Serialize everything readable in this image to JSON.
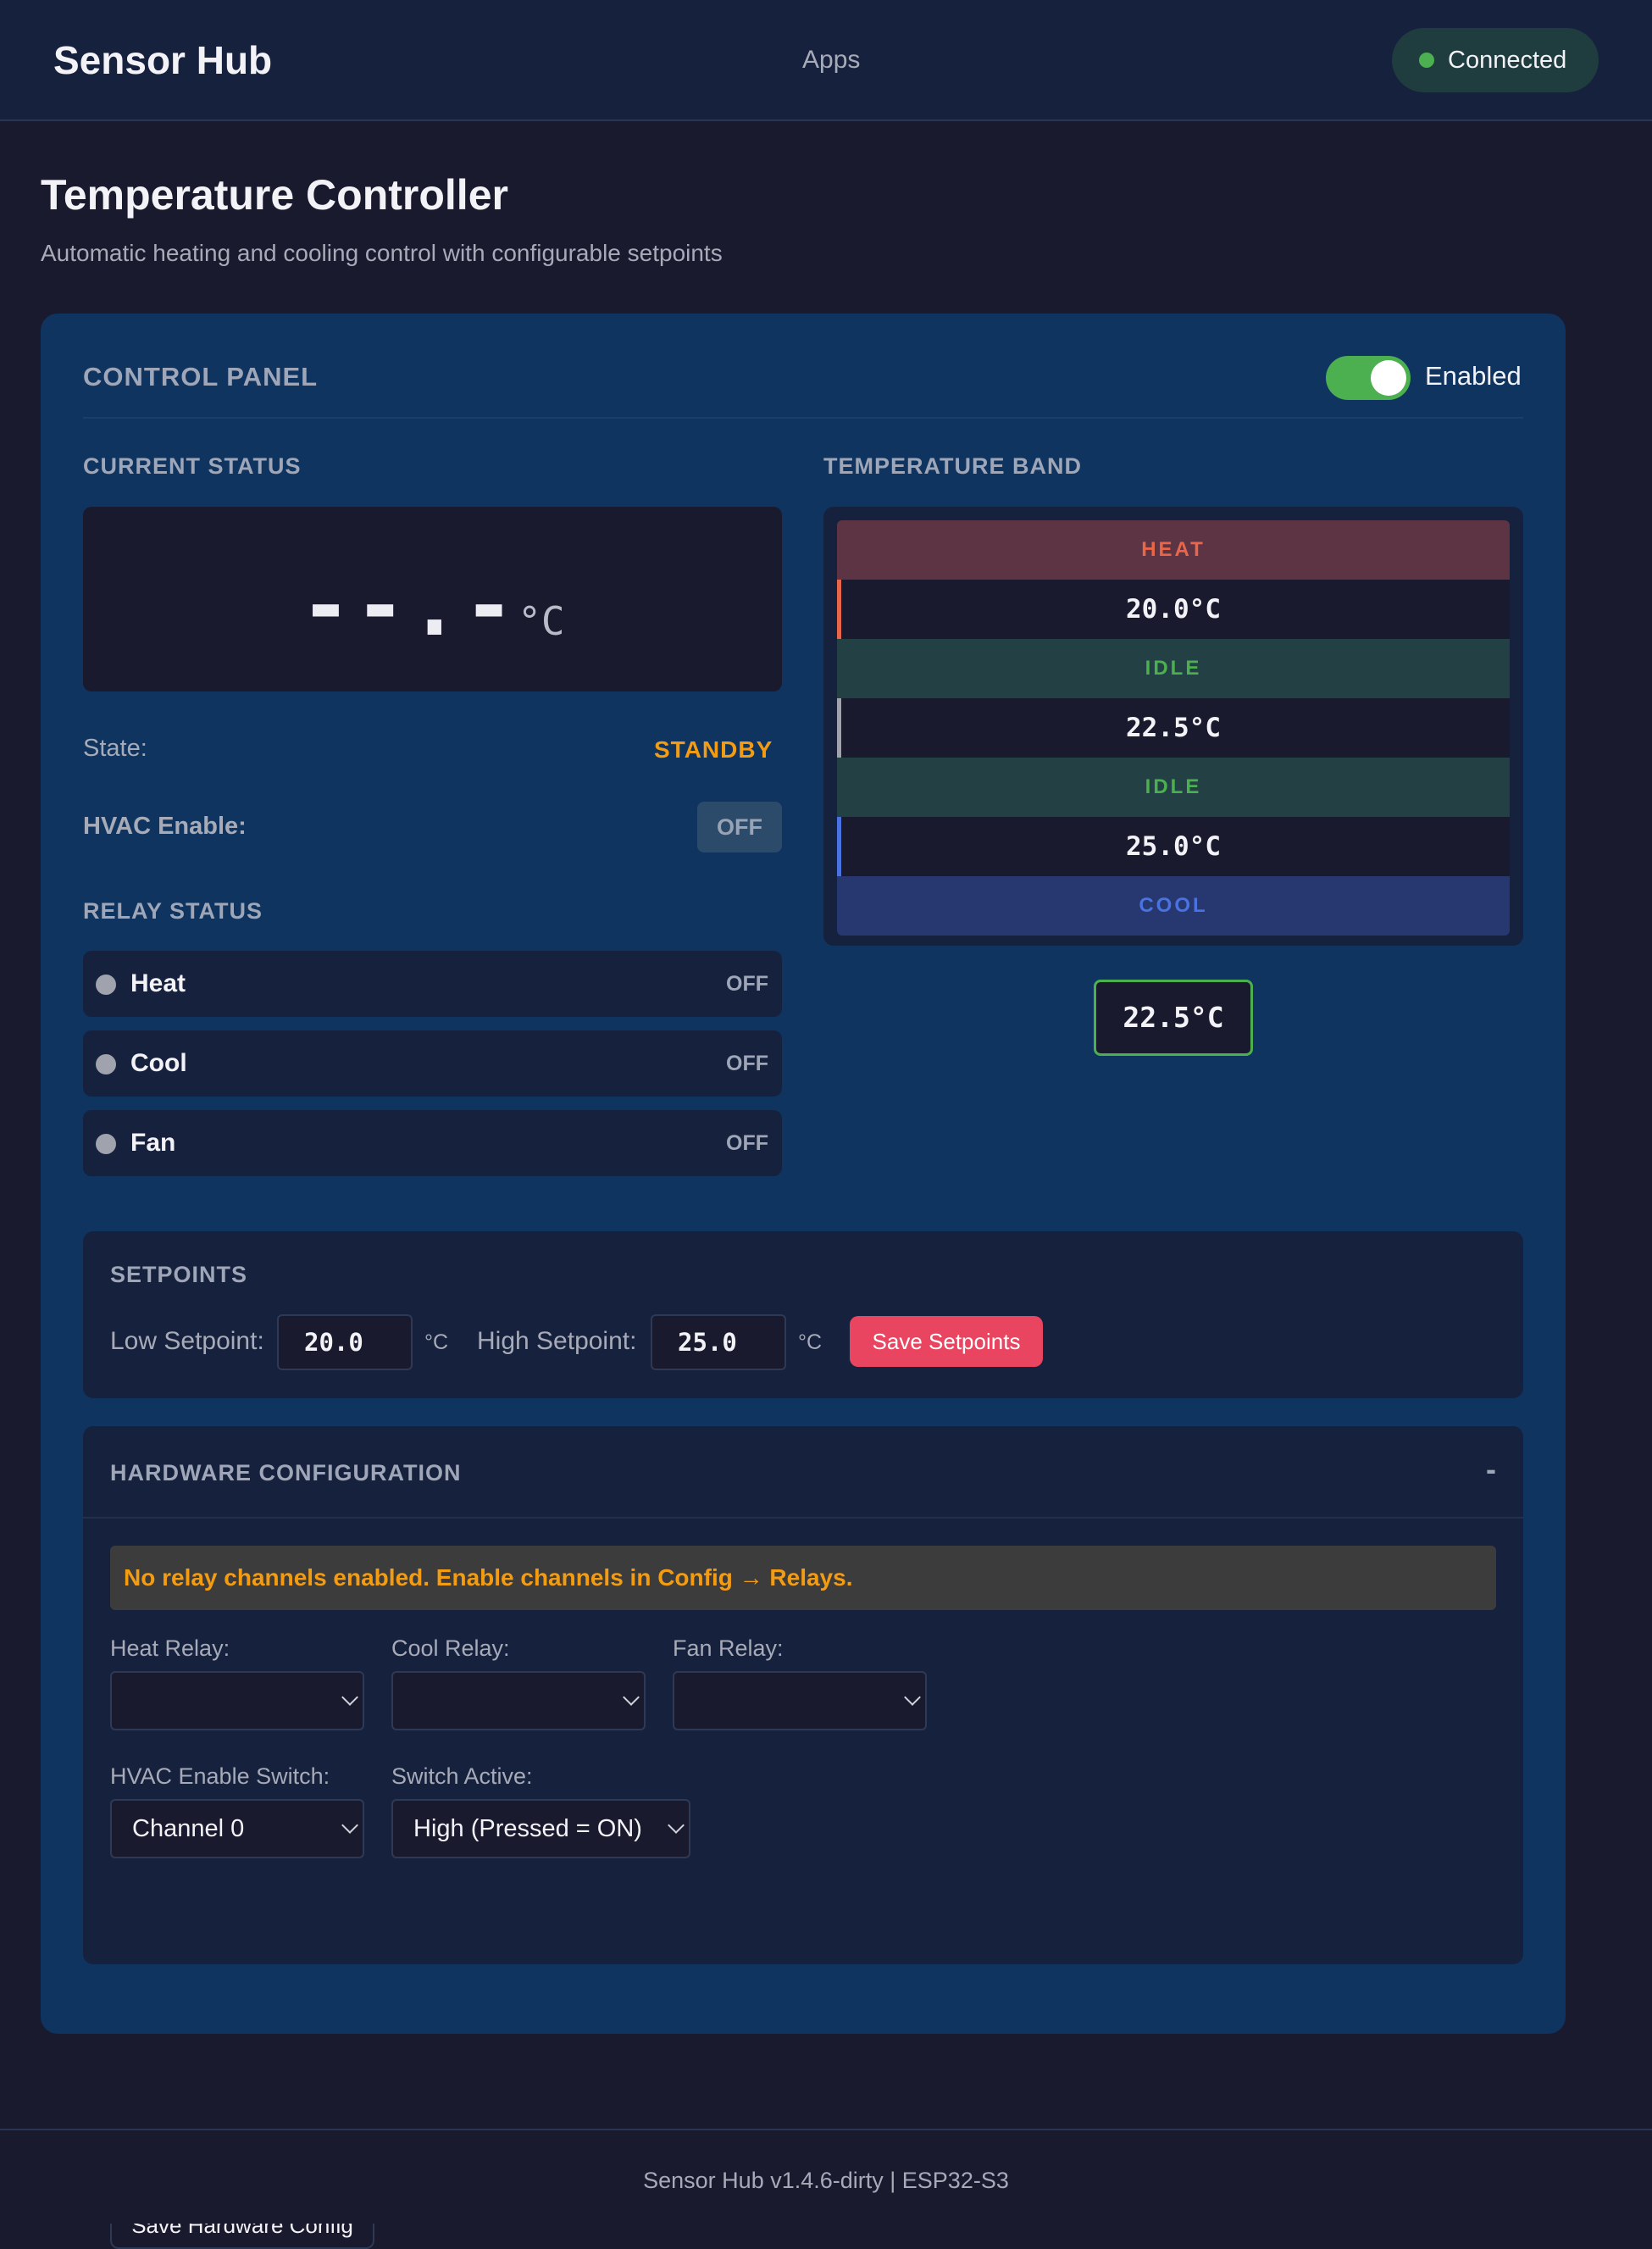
{
  "header": {
    "brand": "Sensor Hub",
    "nav_apps": "Apps",
    "connection_status": "Connected"
  },
  "page": {
    "title": "Temperature Controller",
    "subtitle": "Automatic heating and cooling control with configurable setpoints"
  },
  "control_panel": {
    "title": "CONTROL PANEL",
    "enabled_label": "Enabled",
    "enabled": true,
    "current_status": {
      "label": "CURRENT STATUS",
      "temperature": "--.-",
      "unit": "°C",
      "state_label": "State:",
      "state_value": "STANDBY",
      "hvac_label": "HVAC Enable:",
      "hvac_value": "OFF"
    },
    "relay_status": {
      "label": "RELAY STATUS",
      "relays": [
        {
          "name": "Heat",
          "state": "OFF"
        },
        {
          "name": "Cool",
          "state": "OFF"
        },
        {
          "name": "Fan",
          "state": "OFF"
        }
      ]
    },
    "temperature_band": {
      "label": "TEMPERATURE BAND",
      "rows": [
        {
          "type": "zone",
          "text": "HEAT"
        },
        {
          "type": "temp",
          "text": "20.0°C"
        },
        {
          "type": "zone",
          "text": "IDLE"
        },
        {
          "type": "temp",
          "text": "22.5°C"
        },
        {
          "type": "zone",
          "text": "IDLE"
        },
        {
          "type": "temp",
          "text": "25.0°C"
        },
        {
          "type": "zone",
          "text": "COOL"
        }
      ],
      "current_marker": "22.5°C"
    }
  },
  "setpoints": {
    "title": "SETPOINTS",
    "low_label": "Low Setpoint:",
    "low_value": "20.0",
    "high_label": "High Setpoint:",
    "high_value": "25.0",
    "unit": "°C",
    "save_label": "Save Setpoints"
  },
  "hardware": {
    "title": "HARDWARE CONFIGURATION",
    "collapse_symbol": "-",
    "warning": "No relay channels enabled. Enable channels in Config → Relays.",
    "heat_relay_label": "Heat Relay:",
    "heat_relay_value": "",
    "cool_relay_label": "Cool Relay:",
    "cool_relay_value": "",
    "fan_relay_label": "Fan Relay:",
    "fan_relay_value": "",
    "hvac_switch_label": "HVAC Enable Switch:",
    "hvac_switch_value": "Channel 0",
    "switch_active_label": "Switch Active:",
    "switch_active_value": "High (Pressed = ON)",
    "save_label": "Save Hardware Config"
  },
  "footer": {
    "text": "Sensor Hub v1.4.6-dirty | ESP32-S3"
  },
  "colors": {
    "background": "#1a1a2e",
    "card": "#0f3460",
    "accent": "#e94560",
    "success": "#4caf50",
    "warning": "#f39c12",
    "heat": "#e8674a",
    "cool": "#4a72e0"
  }
}
